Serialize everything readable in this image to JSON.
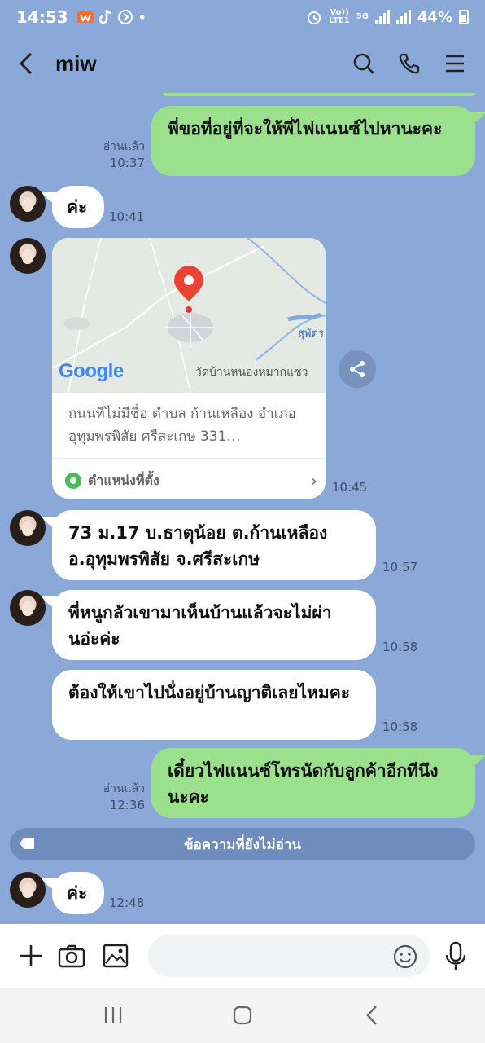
{
  "status_bar": {
    "time": "14:53",
    "network_top": "Vo))",
    "network_bottom": "LTE1",
    "network_5g": "5G",
    "battery": "44%"
  },
  "header": {
    "title": "miw",
    "icons": [
      "back-arrow-icon",
      "search-icon",
      "phone-icon",
      "menu-icon"
    ]
  },
  "messages": [
    {
      "id": "m1",
      "side": "out",
      "text": "พี่ขอที่อยู่ที่จะให้พี่ไฟแนนซ์ไปหานะคะ",
      "read": "อ่านแล้ว",
      "time": "10:37"
    },
    {
      "id": "m2",
      "side": "in",
      "text": "ค่ะ",
      "time": "10:41"
    },
    {
      "id": "m3",
      "side": "in",
      "type": "location",
      "map_labels": {
        "town": "สุพัตร",
        "temple": "วัดบ้านหนองหมากแซว",
        "logo": "Google"
      },
      "address": "ถนนที่ไม่มีชื่อ ตำบล ก้านเหลือง อำเภออุทุมพรพิสัย ศรีสะเกษ 331…",
      "footer": "ตำแหน่งที่ตั้ง",
      "time": "10:45"
    },
    {
      "id": "m4",
      "side": "in",
      "text": "73 ม.17 บ.ธาตุน้อย ต.ก้านเหลือง อ.อุทุมพรพิสัย จ.ศรีสะเกษ",
      "time": "10:57"
    },
    {
      "id": "m5",
      "side": "in",
      "text": "พี่หนูกลัวเขามาเห็นบ้านแล้วจะไม่ผ่านอ่ะค่ะ",
      "time": "10:58"
    },
    {
      "id": "m6",
      "side": "in",
      "text": "ต้องให้เขาไปนั่งอยู่บ้านญาติเลยไหมคะ",
      "time": "10:58"
    },
    {
      "id": "m7",
      "side": "out",
      "text": "เดี๋ยวไฟแนนซ์โทรนัดกับลูกค้าอีกทีนึงนะคะ",
      "read": "อ่านแล้ว",
      "time": "12:36"
    },
    {
      "id": "m8",
      "side": "in",
      "text": "ค่ะ",
      "time": "12:48"
    }
  ],
  "unread_banner": "ข้อความที่ยังไม่อ่าน",
  "composer": {
    "placeholder": ""
  },
  "colors": {
    "background": "#8aa8d8",
    "outgoing_bubble": "#9be08c",
    "incoming_bubble": "#ffffff"
  }
}
